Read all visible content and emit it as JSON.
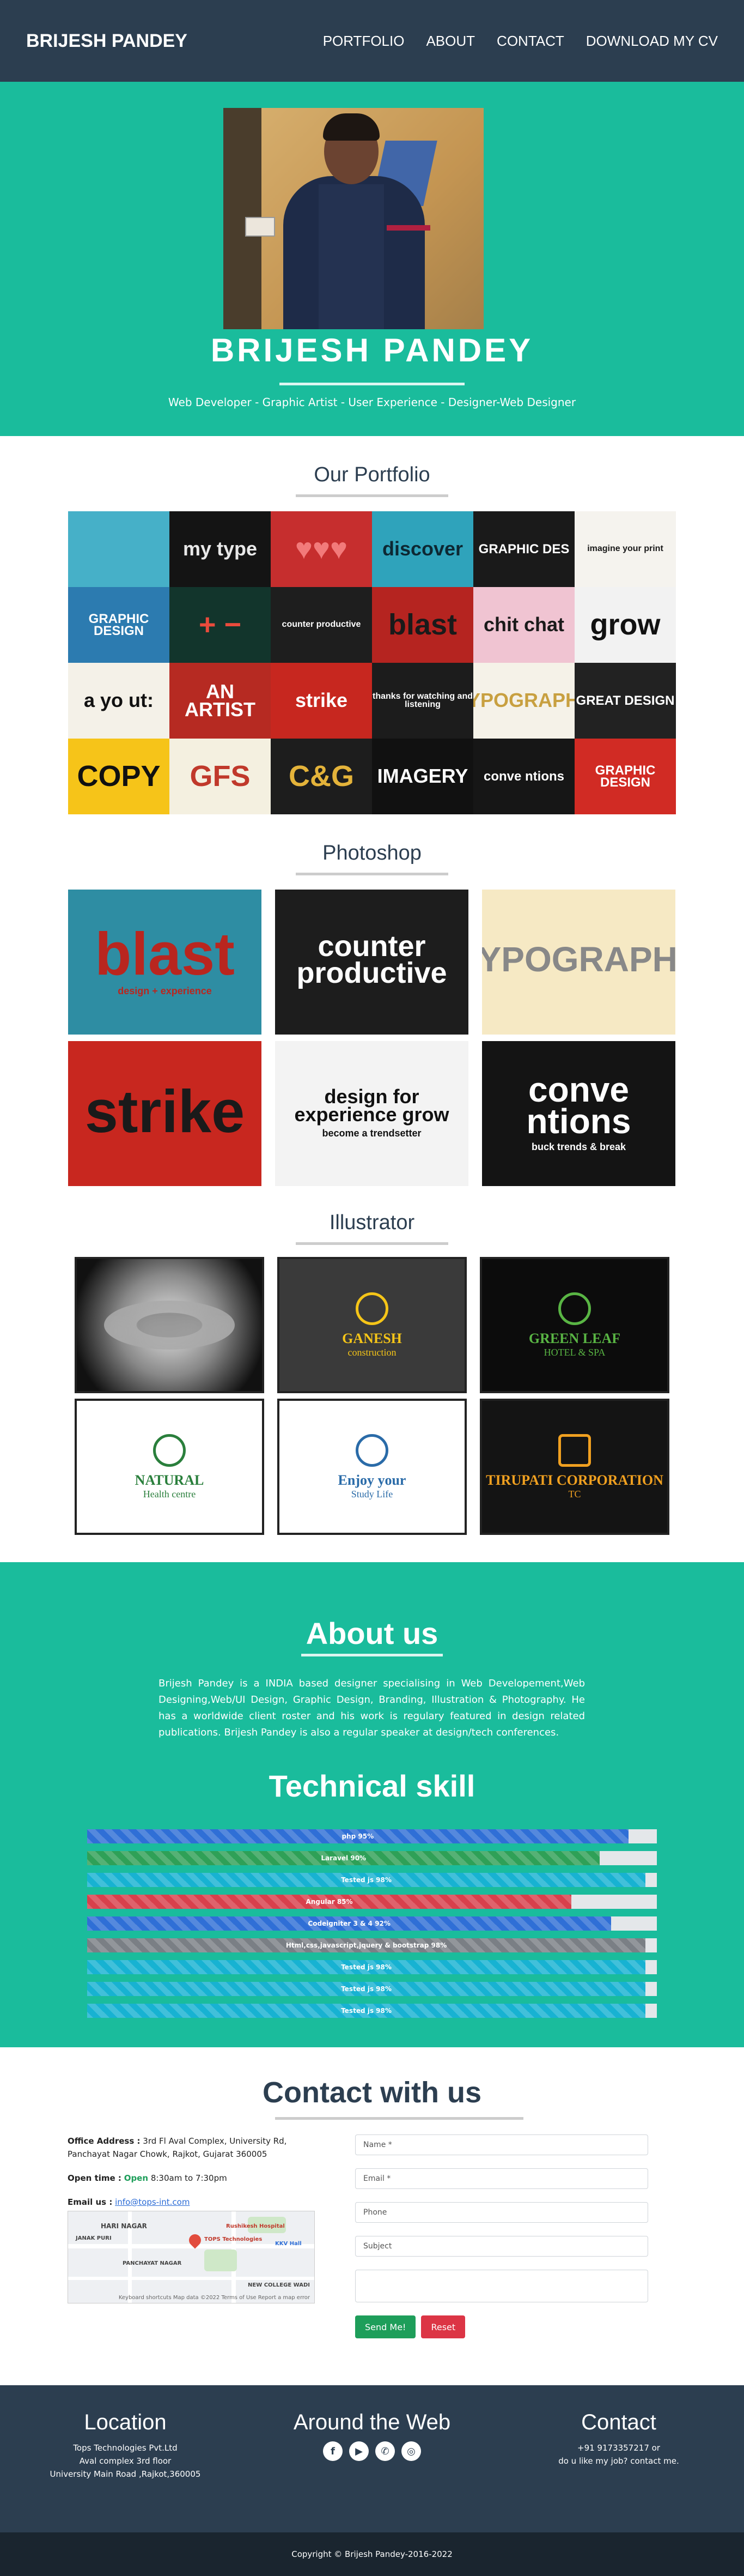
{
  "nav": {
    "brand": "BRIJESH PANDEY",
    "links": [
      "PORTFOLIO",
      "ABOUT",
      "CONTACT",
      "DOWNLOAD MY CV"
    ]
  },
  "hero": {
    "title": "BRIJESH PANDEY",
    "subtitle": "Web Developer - Graphic Artist - User Experience - Designer-Web Designer"
  },
  "portfolio": {
    "title": "Our Portfolio",
    "tiles": [
      {
        "text": "",
        "bg": "#46b0c8",
        "fg": "#fff"
      },
      {
        "text": "my type",
        "bg": "#141414",
        "fg": "#e8e8e8"
      },
      {
        "text": "♥♥♥",
        "bg": "#c62e2e",
        "fg": "#f27a7a"
      },
      {
        "text": "discover",
        "bg": "#2fa3bb",
        "fg": "#0d2833"
      },
      {
        "text": "GRAPHIC DES",
        "bg": "#1a1a1a",
        "fg": "#fff"
      },
      {
        "text": "imagine your print",
        "bg": "#f5f3ee",
        "fg": "#1a1a1a"
      },
      {
        "text": "GRAPHIC DESIGN",
        "bg": "#2c7bb0",
        "fg": "#fff"
      },
      {
        "text": "+ −",
        "bg": "#12352c",
        "fg": "#e94b3c"
      },
      {
        "text": "counter productive",
        "bg": "#1e1e1e",
        "fg": "#fff"
      },
      {
        "text": "blast",
        "bg": "#b52420",
        "fg": "#1a1a1a"
      },
      {
        "text": "chit chat",
        "bg": "#f0c4d2",
        "fg": "#1a1a1a"
      },
      {
        "text": "grow",
        "bg": "#f2f2f2",
        "fg": "#111"
      },
      {
        "text": "a yo ut:",
        "bg": "#f4f1e8",
        "fg": "#111"
      },
      {
        "text": "AN ARTIST",
        "bg": "#b62a22",
        "fg": "#fff"
      },
      {
        "text": "strike",
        "bg": "#c7271f",
        "fg": "#fff"
      },
      {
        "text": "thanks for watching and listening",
        "bg": "#1c1c1c",
        "fg": "#fff"
      },
      {
        "text": "TYPOGRAPHY",
        "bg": "#f5f2e8",
        "fg": "#c8a040"
      },
      {
        "text": "GREAT DESIGN",
        "bg": "#222",
        "fg": "#fff"
      },
      {
        "text": "COPY",
        "bg": "#f6c419",
        "fg": "#111"
      },
      {
        "text": "GFS",
        "bg": "#f4f0e0",
        "fg": "#c0392b"
      },
      {
        "text": "C&G",
        "bg": "#1d1d1d",
        "fg": "#e4b33a"
      },
      {
        "text": "IMAGERY",
        "bg": "#111",
        "fg": "#fff"
      },
      {
        "text": "conve ntions",
        "bg": "#161616",
        "fg": "#fff"
      },
      {
        "text": "GRAPHIC DESIGN",
        "bg": "#d12b24",
        "fg": "#fff"
      }
    ]
  },
  "photoshop": {
    "title": "Photoshop",
    "cards": [
      {
        "text": "blast",
        "sub": "design + experience",
        "bg": "#2e8da3",
        "fg": "#b9261f"
      },
      {
        "text": "counter productive",
        "sub": "",
        "bg": "#1d1d1d",
        "fg": "#fff"
      },
      {
        "text": "TYPOGRAPHY",
        "sub": "",
        "bg": "#f6e9c4",
        "fg": "#888"
      },
      {
        "text": "strike",
        "sub": "",
        "bg": "#c8271f",
        "fg": "#1a1a1a"
      },
      {
        "text": "design for experience grow",
        "sub": "become a trendsetter",
        "bg": "#f3f3f3",
        "fg": "#111"
      },
      {
        "text": "conve ntions",
        "sub": "buck trends & break",
        "bg": "#141414",
        "fg": "#fff"
      }
    ]
  },
  "illustrator": {
    "title": "Illustrator",
    "cards": [
      {
        "name": "",
        "tag": "",
        "bg": "#111",
        "fg": "#fff"
      },
      {
        "name": "GANESH",
        "tag": "construction",
        "bg": "#3a3a3a",
        "fg": "#f5c518"
      },
      {
        "name": "GREEN LEAF",
        "tag": "HOTEL & SPA",
        "bg": "#0c0c0c",
        "fg": "#59b544"
      },
      {
        "name": "NATURAL",
        "tag": "Health centre",
        "bg": "#fff",
        "fg": "#2a7f3c"
      },
      {
        "name": "Enjoy your",
        "tag": "Study Life",
        "bg": "#fff",
        "fg": "#2a6ba8"
      },
      {
        "name": "TIRUPATI CORPORATION",
        "tag": "TC",
        "bg": "#141414",
        "fg": "#f0a020"
      }
    ]
  },
  "about": {
    "title": "About us",
    "text": "Brijesh Pandey is a INDIA based designer specialising in Web Developement,Web Designing,Web/UI Design, Graphic Design, Branding, Illustration & Photography. He has a worldwide client roster and his work is regulary featured in design related publications. Brijesh Pandey is also a regular speaker at design/tech conferences."
  },
  "tech": {
    "title": "Technical skill",
    "skills": [
      {
        "label": "php 95%",
        "value": 95,
        "color": "#2f6fd6"
      },
      {
        "label": "Laravel 90%",
        "value": 90,
        "color": "#2fa057"
      },
      {
        "label": "Tested js 98%",
        "value": 98,
        "color": "#17b2d2"
      },
      {
        "label": "Angular 85%",
        "value": 85,
        "color": "#d8404c"
      },
      {
        "label": "Codeigniter 3 & 4 92%",
        "value": 92,
        "color": "#2f6fd6"
      },
      {
        "label": "Html,css,javascript,jquery & bootstrap 98%",
        "value": 98,
        "color": "#7a7f85"
      },
      {
        "label": "Tested js 98%",
        "value": 98,
        "color": "#17b2d2"
      },
      {
        "label": "Tested js 98%",
        "value": 98,
        "color": "#17b2d2"
      },
      {
        "label": "Tested js 98%",
        "value": 98,
        "color": "#17b2d2"
      }
    ]
  },
  "contact": {
    "title": "Contact with us",
    "address_label": "Office Address :",
    "address": "3rd Fl Aval Complex, University Rd, Panchayat Nagar Chowk, Rajkot, Gujarat 360005",
    "open_label": "Open time :",
    "open_status": "Open",
    "open_hours": "8:30am to 7:30pm",
    "email_label": "Email us :",
    "email": "info@tops-int.com",
    "map": {
      "labels": [
        "HARI NAGAR",
        "JANAK PURI",
        "PANCHAYAT NAGAR",
        "Rushikesh Hospital",
        "TOPS Technologies",
        "KKV Hall",
        "NEW COLLEGE WADI"
      ],
      "attribution": "Keyboard shortcuts  Map data ©2022  Terms of Use  Report a map error"
    },
    "fields": [
      "Name *",
      "Email *",
      "Phone",
      "Subject",
      ""
    ],
    "send": "Send Me!",
    "reset": "Reset"
  },
  "footer": {
    "location_title": "Location",
    "location_lines": [
      "Tops Technologies Pvt.Ltd",
      "Aval complex 3rd floor",
      "University Main Road ,Rajkot,360005"
    ],
    "web_title": "Around the Web",
    "icons": [
      {
        "name": "facebook-icon",
        "glyph": "f"
      },
      {
        "name": "youtube-icon",
        "glyph": "▶"
      },
      {
        "name": "whatsapp-icon",
        "glyph": "✆"
      },
      {
        "name": "instagram-icon",
        "glyph": "◎"
      }
    ],
    "contact_title": "Contact",
    "contact_lines": [
      "+91 9173357217 or",
      "do u like my job? contact me."
    ],
    "copyright": "Copyright © Brijesh Pandey-2016-2022"
  }
}
